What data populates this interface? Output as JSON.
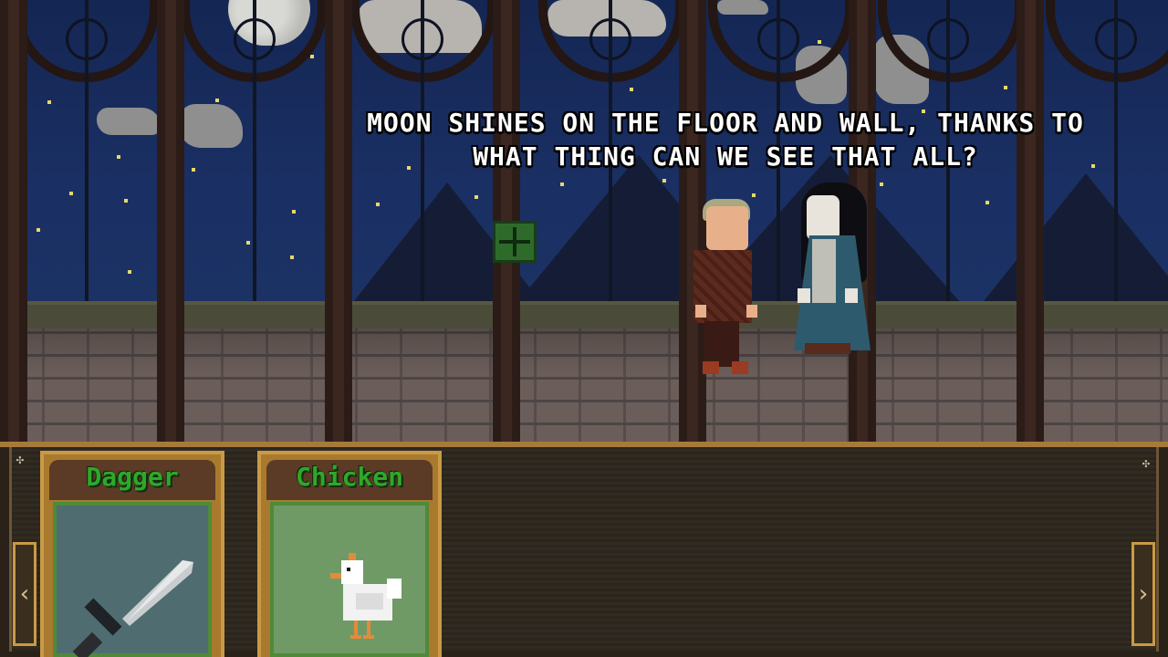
{
  "dialogue": {
    "line1": "MOON SHINES ON THE FLOOR AND WALL, THANKS TO",
    "line2": "WHAT THING CAN WE SEE THAT ALL?"
  },
  "inventory": {
    "items": [
      {
        "label": "Dagger",
        "icon": "dagger-icon"
      },
      {
        "label": "Chicken",
        "icon": "chicken-icon"
      }
    ],
    "prev_arrow": "‹",
    "next_arrow": "›"
  },
  "colors": {
    "sky": "#1a2f63",
    "item_label": "#2ea82a",
    "card_frame": "#c99a46",
    "inventory_bg": "#2d2820"
  }
}
